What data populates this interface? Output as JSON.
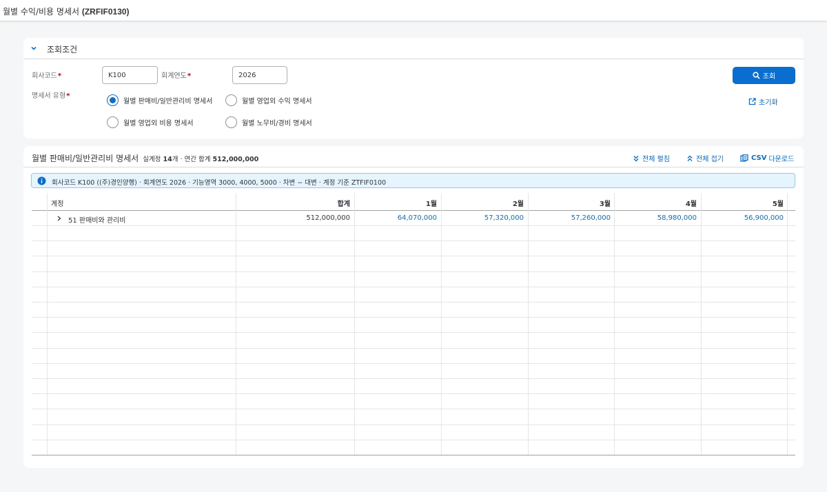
{
  "header": {
    "title_prefix": "월별 수익/비용 명세서 ",
    "title_code": "(ZRFIF0130)"
  },
  "filters": {
    "section_label": "조회조건",
    "company_code_label": "회사코드",
    "company_code_value": "K100",
    "fiscal_year_label": "회계연도",
    "fiscal_year_value": "2026",
    "statement_type_label": "명세서 유형",
    "radio_options": [
      {
        "label": "월별 판매비/일반관리비 명세서",
        "selected": true
      },
      {
        "label": "월별 영업외 수익 명세서",
        "selected": false
      },
      {
        "label": "월별 영업외 비용 명세서",
        "selected": false
      },
      {
        "label": "월별 노무비/경비 명세서",
        "selected": false
      }
    ],
    "search_button": "조회",
    "reset_button": "초기화"
  },
  "results": {
    "title": "월별 판매비/일반관리비 명세서",
    "meta_prefix": "실계정 ",
    "meta_count": "14",
    "meta_mid": "개 · 연간 합계 ",
    "meta_total": "512,000,000",
    "expand_all": "전체 펼침",
    "collapse_all": "전체 접기",
    "csv_download": "CSV 다운로드",
    "info_text": "회사코드 K100 ((주)경인양행) · 회계연도 2026 · 기능영역 3000, 4000, 5000 · 차변 − 대변 · 계정 기준 ZTFIF0100",
    "columns": [
      "계정",
      "합계",
      "1월",
      "2월",
      "3월",
      "4월",
      "5월"
    ],
    "rows": [
      {
        "account": "51 판매비와 관리비",
        "total": "512,000,000",
        "months": [
          "64,070,000",
          "57,320,000",
          "57,260,000",
          "58,980,000",
          "56,900,000"
        ]
      }
    ]
  },
  "colors": {
    "accent": "#0a6ed1",
    "required": "#bb0000",
    "info_bg": "#e5f4fd"
  }
}
